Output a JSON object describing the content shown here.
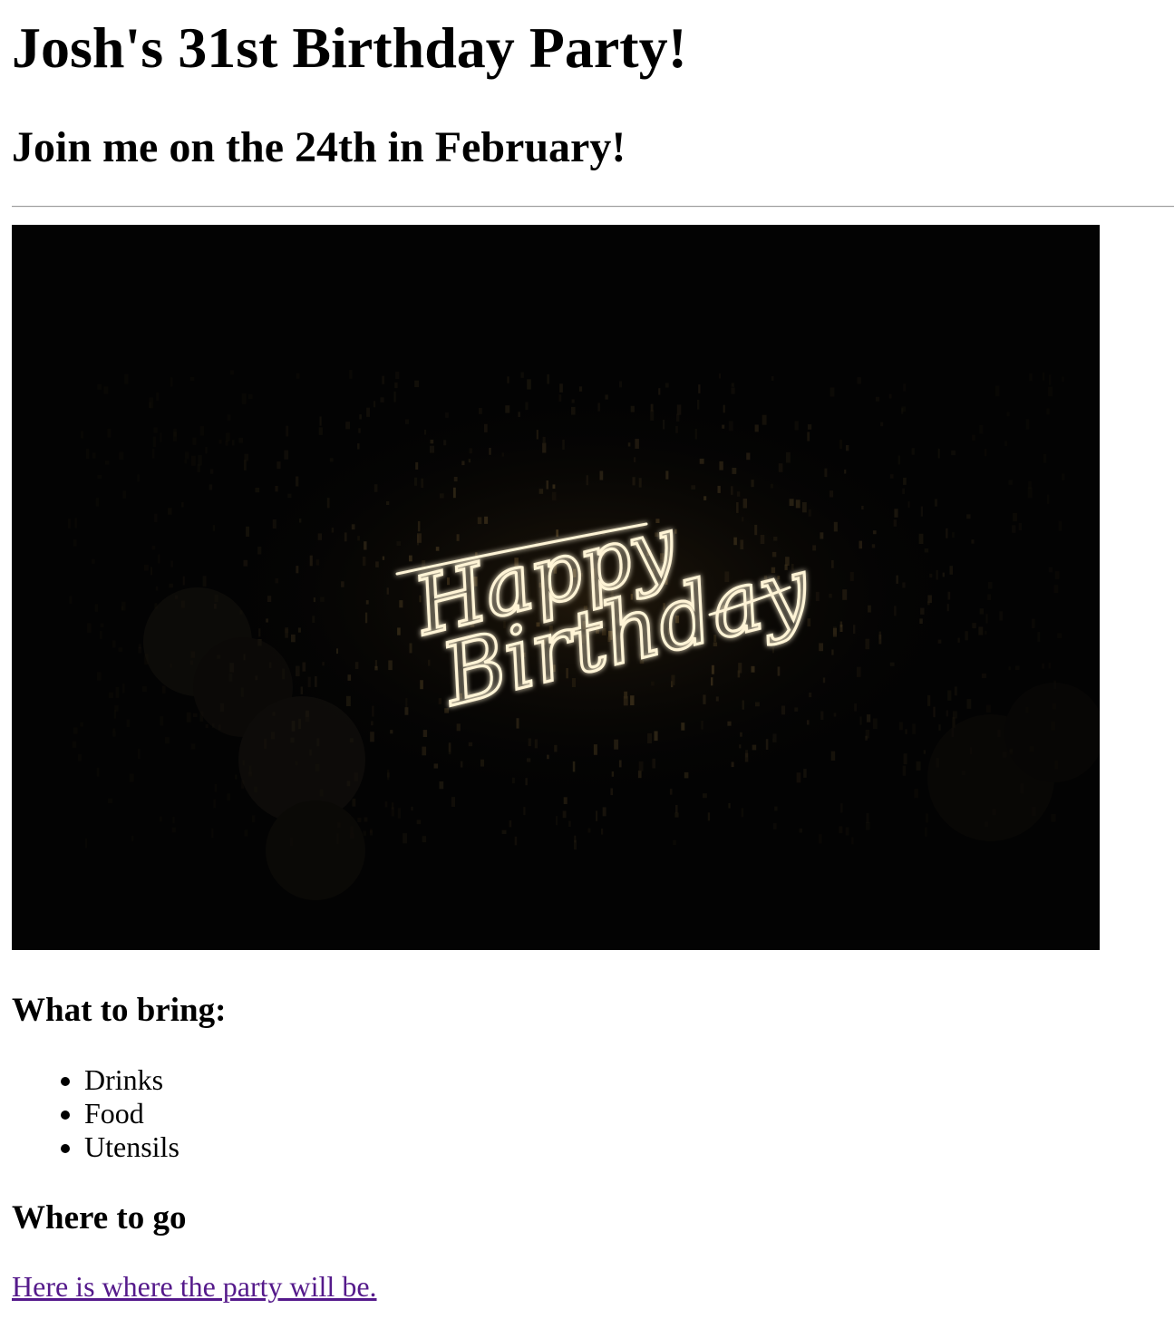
{
  "header": {
    "title": "Josh's 31st Birthday Party!",
    "subtitle": "Join me on the 24th in February!"
  },
  "photo": {
    "alt": "Happy Birthday",
    "sign_line1": "Happy",
    "sign_line2": "Birthday"
  },
  "bring": {
    "heading": "What to bring:",
    "items": [
      "Drinks",
      "Food",
      "Utensils"
    ]
  },
  "where": {
    "heading": "Where to go",
    "link_text": "Here is where the party will be."
  },
  "colors": {
    "visited_link": "#551a8b",
    "photo_background": "#030303",
    "neon": "#fff4d6"
  }
}
